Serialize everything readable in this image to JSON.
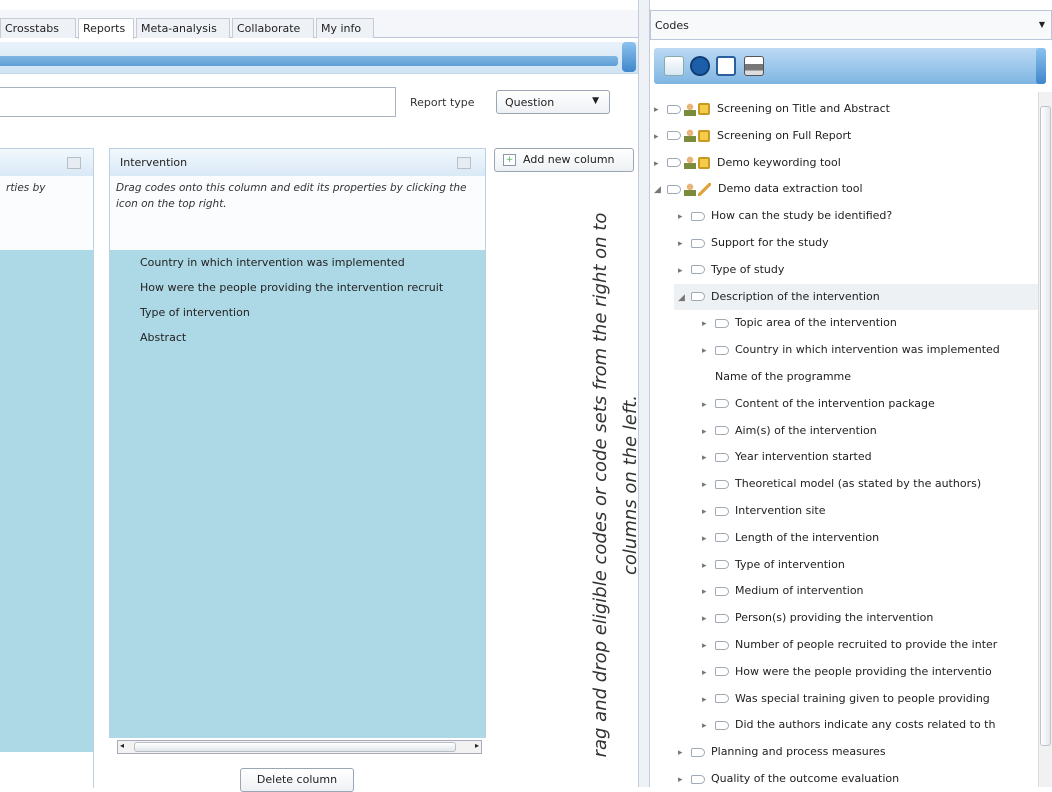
{
  "tabs": [
    "Crosstabs",
    "Reports",
    "Meta-analysis",
    "Collaborate",
    "My info"
  ],
  "active_tab": "Reports",
  "search": {
    "value": ""
  },
  "report_type": {
    "label": "Report type",
    "value": "Question"
  },
  "left_column": {
    "hint": "rties by"
  },
  "intervention_column": {
    "title": "Intervention",
    "hint": "Drag codes onto this column and edit its properties by clicking the icon on the top right.",
    "items": [
      "Country in which intervention was implemented",
      "How were the people providing the intervention recruit",
      "Type of intervention",
      "Abstract"
    ],
    "delete_label": "Delete column"
  },
  "add_column_label": "Add new column",
  "drag_hint": "rag and drop eligible codes or code sets from the right on to columns on the left.",
  "codes_panel": {
    "title": "Codes",
    "tree": [
      {
        "label": "Screening on Title and Abstract",
        "level": 0,
        "exp": "▸",
        "icons": [
          "users",
          "lock"
        ]
      },
      {
        "label": "Screening on Full Report",
        "level": 0,
        "exp": "▸",
        "icons": [
          "users",
          "lock"
        ]
      },
      {
        "label": "Demo keywording tool",
        "level": 0,
        "exp": "▸",
        "icons": [
          "user",
          "lock"
        ]
      },
      {
        "label": "Demo data extraction tool",
        "level": 0,
        "exp": "◢",
        "icons": [
          "user",
          "pencil"
        ]
      },
      {
        "label": "How can the study be identified?",
        "level": 1,
        "exp": "▸",
        "icons": []
      },
      {
        "label": "Support for the study",
        "level": 1,
        "exp": "▸",
        "icons": []
      },
      {
        "label": "Type of study",
        "level": 1,
        "exp": "▸",
        "icons": []
      },
      {
        "label": "Description of the intervention",
        "level": 1,
        "exp": "◢",
        "icons": [],
        "highlight": true
      },
      {
        "label": "Topic area of the intervention",
        "level": 2,
        "exp": "▸",
        "icons": []
      },
      {
        "label": "Country in which intervention was implemented",
        "level": 2,
        "exp": "▸",
        "icons": []
      },
      {
        "label": "Name of the programme",
        "level": 2,
        "exp": "",
        "icons": [],
        "noarrow": true
      },
      {
        "label": "Content of the intervention package",
        "level": 2,
        "exp": "▸",
        "icons": []
      },
      {
        "label": "Aim(s) of the intervention",
        "level": 2,
        "exp": "▸",
        "icons": []
      },
      {
        "label": "Year intervention started",
        "level": 2,
        "exp": "▸",
        "icons": []
      },
      {
        "label": "Theoretical model (as stated by the authors)",
        "level": 2,
        "exp": "▸",
        "icons": []
      },
      {
        "label": "Intervention site",
        "level": 2,
        "exp": "▸",
        "icons": []
      },
      {
        "label": "Length of the intervention",
        "level": 2,
        "exp": "▸",
        "icons": []
      },
      {
        "label": "Type of intervention",
        "level": 2,
        "exp": "▸",
        "icons": []
      },
      {
        "label": "Medium of intervention",
        "level": 2,
        "exp": "▸",
        "icons": []
      },
      {
        "label": "Person(s) providing the intervention",
        "level": 2,
        "exp": "▸",
        "icons": []
      },
      {
        "label": "Number of people recruited to provide the inter",
        "level": 2,
        "exp": "▸",
        "icons": []
      },
      {
        "label": "How were the people providing the interventio",
        "level": 2,
        "exp": "▸",
        "icons": []
      },
      {
        "label": "Was special training given to people providing",
        "level": 2,
        "exp": "▸",
        "icons": []
      },
      {
        "label": "Did the authors indicate any costs related to th",
        "level": 2,
        "exp": "▸",
        "icons": []
      },
      {
        "label": "Planning and process measures",
        "level": 1,
        "exp": "▸",
        "icons": []
      },
      {
        "label": "Quality of the outcome evaluation",
        "level": 1,
        "exp": "▸",
        "icons": []
      }
    ]
  }
}
